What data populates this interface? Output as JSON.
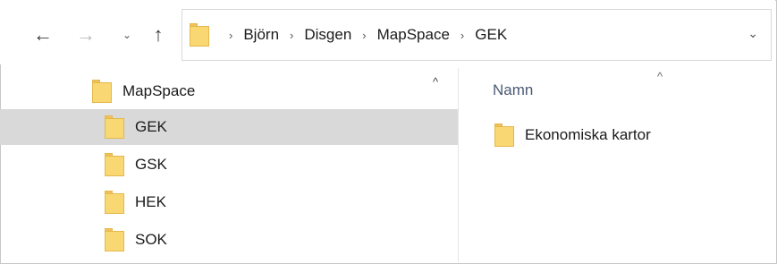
{
  "navigation": {
    "back_icon": "←",
    "forward_icon": "→",
    "recent_icon": "⌄",
    "up_icon": "↑"
  },
  "address_bar": {
    "crumbs": [
      "Björn",
      "Disgen",
      "MapSpace",
      "GEK"
    ],
    "separator": "›",
    "dropdown_icon": "⌄"
  },
  "tree": {
    "scroll_up_icon": "^",
    "items": [
      {
        "label": "MapSpace"
      },
      {
        "label": "GEK"
      },
      {
        "label": "GSK"
      },
      {
        "label": "HEK"
      },
      {
        "label": "SOK"
      }
    ]
  },
  "content": {
    "column_header": "Namn",
    "sort_icon": "^",
    "files": [
      {
        "name": "Ekonomiska kartor"
      }
    ]
  }
}
